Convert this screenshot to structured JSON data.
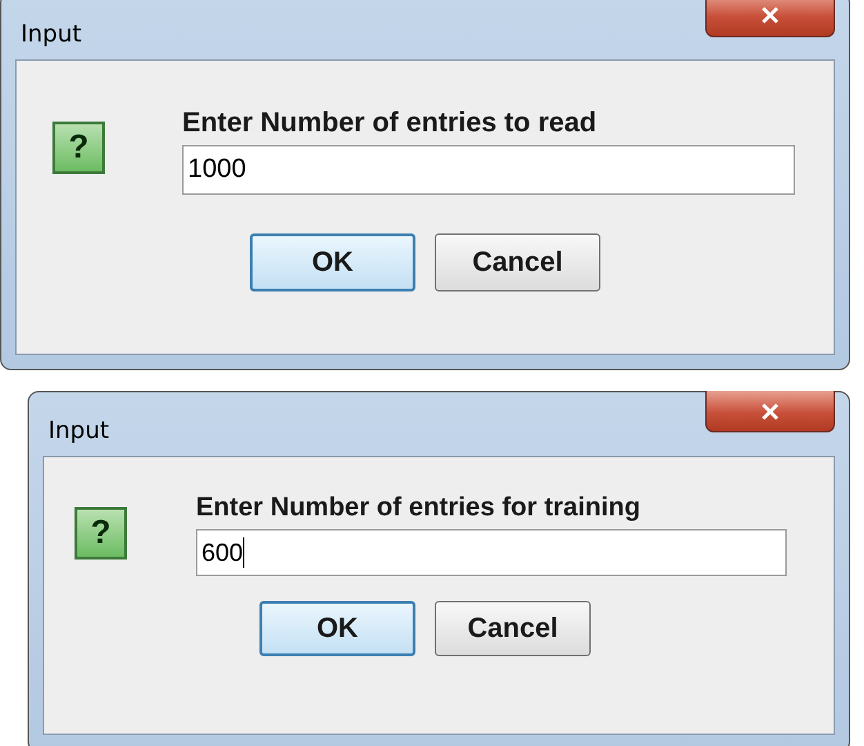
{
  "dialogs": [
    {
      "title": "Input",
      "message": "Enter Number of entries to read",
      "value": "1000",
      "focused": false,
      "icon": "?",
      "buttons": [
        {
          "label": "OK",
          "default": true
        },
        {
          "label": "Cancel",
          "default": false
        }
      ]
    },
    {
      "title": "Input",
      "message": "Enter Number of entries for training",
      "value": "600",
      "focused": true,
      "icon": "?",
      "buttons": [
        {
          "label": "OK",
          "default": true
        },
        {
          "label": "Cancel",
          "default": false
        }
      ]
    }
  ]
}
